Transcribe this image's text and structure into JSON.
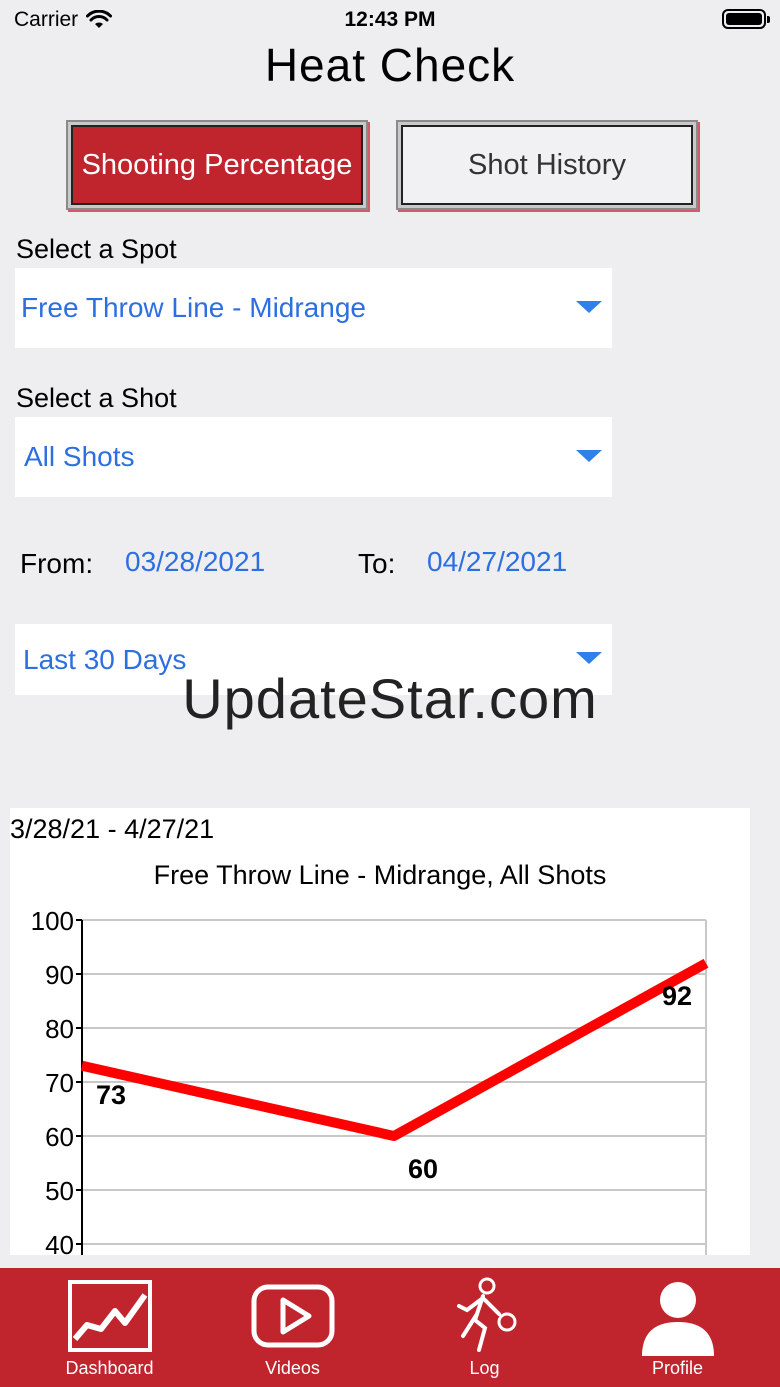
{
  "status": {
    "carrier": "Carrier",
    "time": "12:43 PM"
  },
  "app": {
    "title": "Heat Check"
  },
  "segments": {
    "active_label": "Shooting Percentage",
    "inactive_label": "Shot History"
  },
  "spot": {
    "label": "Select a Spot",
    "value": "Free Throw Line - Midrange"
  },
  "shot": {
    "label": "Select a Shot",
    "value": "All Shots"
  },
  "dates": {
    "from_label": "From:",
    "from_value": "03/28/2021",
    "to_label": "To:",
    "to_value": "04/27/2021"
  },
  "range": {
    "value": "Last 30 Days"
  },
  "watermark": "UpdateStar.com",
  "chart_data": {
    "type": "line",
    "date_range": "3/28/21 - 4/27/21",
    "title": "Free Throw Line - Midrange, All Shots",
    "ylim": [
      40,
      100
    ],
    "y_ticks": [
      "100",
      "90",
      "80",
      "70",
      "60",
      "50",
      "40"
    ],
    "series": [
      {
        "values": [
          73,
          60,
          92
        ]
      }
    ],
    "data_labels": [
      "73",
      "60",
      "92"
    ],
    "line_color": "#ff0000",
    "grid": true
  },
  "tabs": [
    {
      "label": "Dashboard",
      "icon": "chart-icon"
    },
    {
      "label": "Videos",
      "icon": "play-icon"
    },
    {
      "label": "Log",
      "icon": "basketball-player-icon"
    },
    {
      "label": "Profile",
      "icon": "person-icon"
    }
  ],
  "colors": {
    "brand_red": "#c0242c",
    "link_blue": "#2c6fe0",
    "background": "#eeedf0"
  }
}
